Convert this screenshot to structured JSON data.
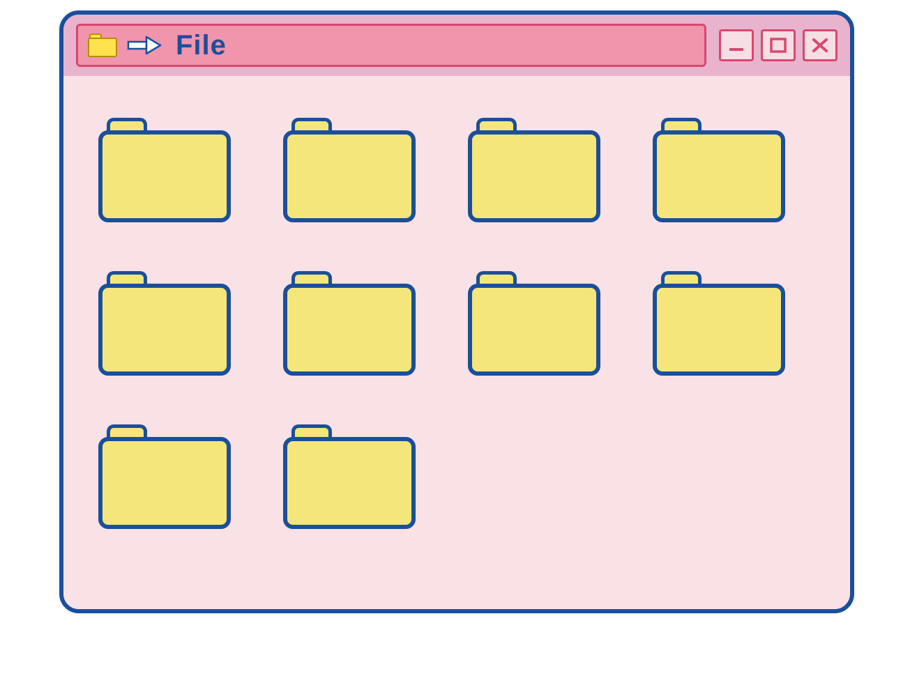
{
  "window": {
    "title": "File",
    "toolbar_icons": {
      "folder": "folder-icon",
      "arrow": "arrow-right-icon"
    },
    "controls": {
      "minimize": "minimize-icon",
      "maximize": "maximize-icon",
      "close": "close-icon"
    }
  },
  "folders": [
    {
      "name": ""
    },
    {
      "name": ""
    },
    {
      "name": ""
    },
    {
      "name": ""
    },
    {
      "name": ""
    },
    {
      "name": ""
    },
    {
      "name": ""
    },
    {
      "name": ""
    },
    {
      "name": ""
    },
    {
      "name": ""
    }
  ],
  "colors": {
    "border": "#1a4f9c",
    "folder": "#f4e67a",
    "titlebar": "#f095ab",
    "menubar": "#e8b4cd",
    "client": "#fae1e6",
    "accent": "#d8486f"
  }
}
